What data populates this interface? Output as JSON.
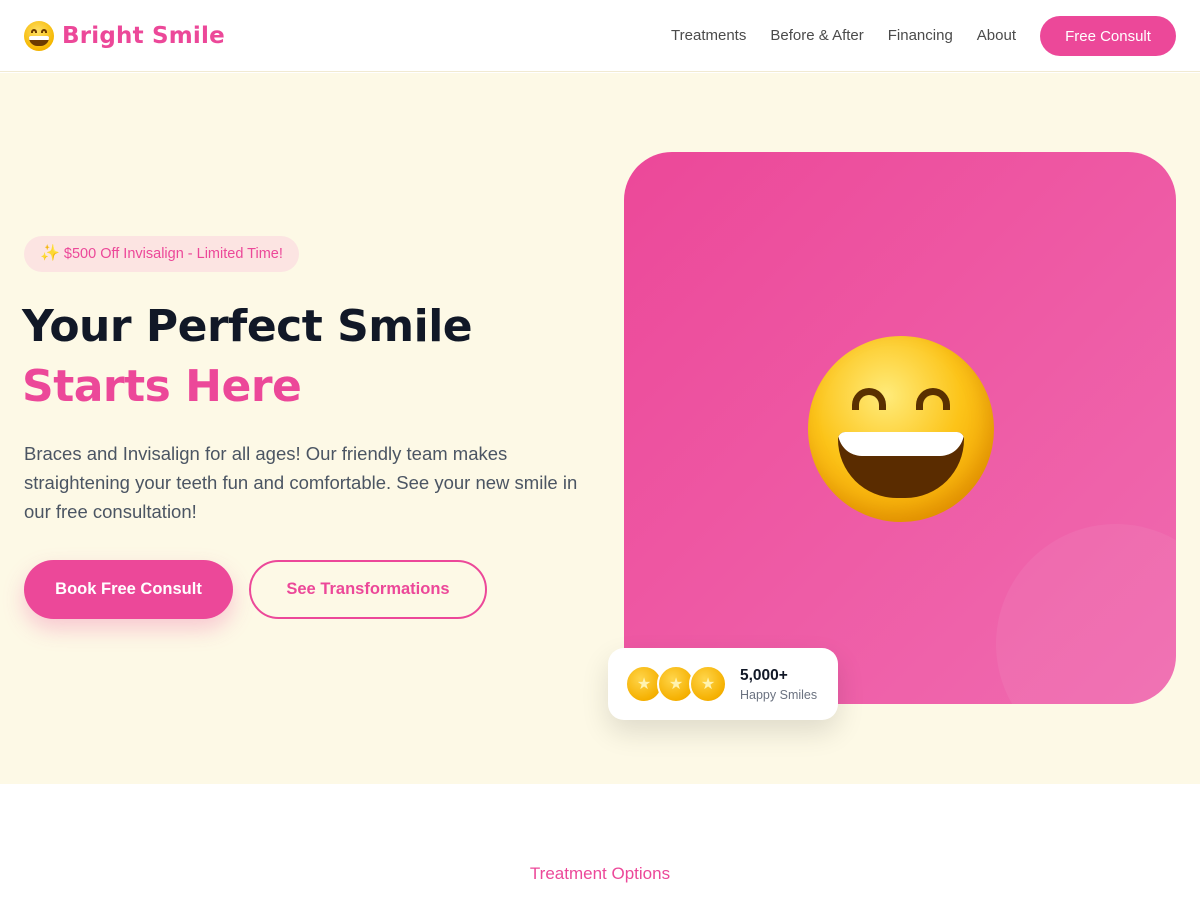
{
  "nav": {
    "logo_text": "Bright Smile",
    "logo_icon": "grinning-face-icon",
    "links": [
      "Treatments",
      "Before & After",
      "Financing",
      "About"
    ],
    "cta": "Free Consult"
  },
  "hero": {
    "promo": "$500 Off Invisalign - Limited Time!",
    "promo_icon": "sparkles-icon",
    "headline_line1": "Your Perfect Smile",
    "headline_line2": "Starts Here",
    "description": "Braces and Invisalign for all ages! Our friendly team makes straightening your teeth fun and comfortable. See your new smile in our free consultation!",
    "primary_button": "Book Free Consult",
    "secondary_button": "See Transformations",
    "image_icon": "grinning-face-icon",
    "stats": {
      "count": "5,000+",
      "label": "Happy Smiles",
      "stars": [
        "star-icon",
        "star-icon",
        "star-icon"
      ]
    }
  },
  "section": {
    "label": "Treatment Options"
  },
  "colors": {
    "accent": "#ec4899",
    "hero_bg": "#fdf9e6",
    "promo_bg": "#fce4e2",
    "heading": "#111827"
  }
}
